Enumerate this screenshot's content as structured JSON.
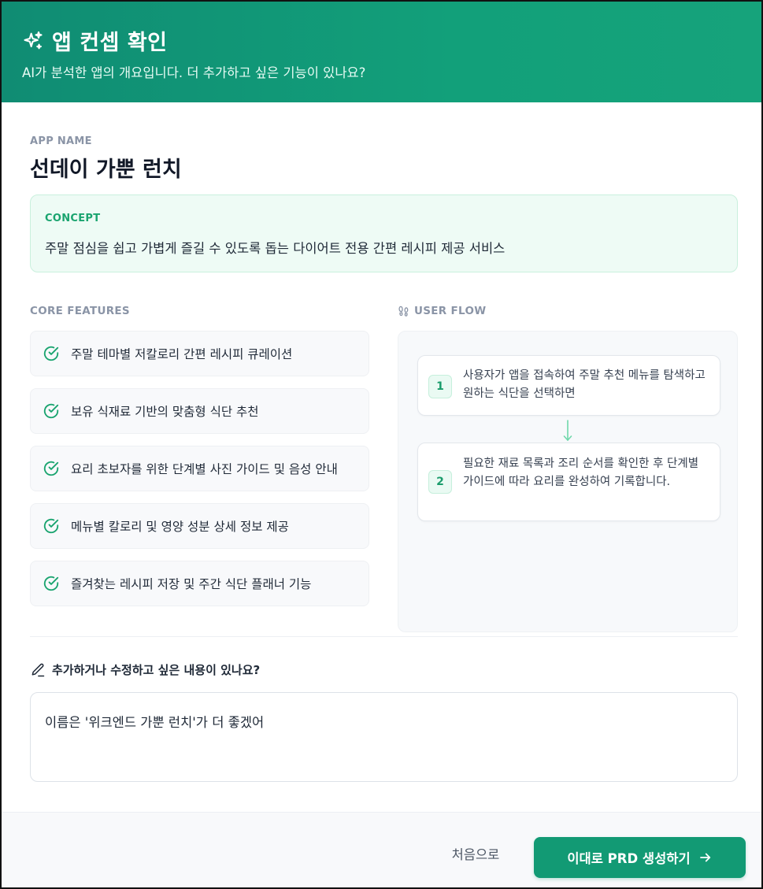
{
  "header": {
    "title": "앱 컨셉 확인",
    "subtitle": "AI가 분석한 앱의 개요입니다. 더 추가하고 싶은 기능이 있나요?"
  },
  "app": {
    "name_label": "APP NAME",
    "name": "선데이 가뿐 런치"
  },
  "concept": {
    "label": "CONCEPT",
    "text": "주말 점심을 쉽고 가볍게 즐길 수 있도록 돕는 다이어트 전용 간편 레시피 제공 서비스"
  },
  "features": {
    "label": "CORE FEATURES",
    "items": [
      "주말 테마별 저칼로리 간편 레시피 큐레이션",
      "보유 식재료 기반의 맞춤형 식단 추천",
      "요리 초보자를 위한 단계별 사진 가이드 및 음성 안내",
      "메뉴별 칼로리 및 영양 성분 상세 정보 제공",
      "즐겨찾는 레시피 저장 및 주간 식단 플래너 기능"
    ]
  },
  "user_flow": {
    "label": "USER FLOW",
    "steps": [
      {
        "num": "1",
        "text": "사용자가 앱을 접속하여 주말 추천 메뉴를 탐색하고 원하는 식단을 선택하면"
      },
      {
        "num": "2",
        "text": "필요한 재료 목록과 조리 순서를 확인한 후 단계별 가이드에 따라 요리를 완성하여 기록합니다."
      }
    ]
  },
  "edit": {
    "label": "추가하거나 수정하고 싶은 내용이 있나요?",
    "value": "이름은 '위크엔드 가뿐 런치'가 더 좋겠어"
  },
  "footer": {
    "back_label": "처음으로",
    "generate_label": "이대로 PRD 생성하기"
  },
  "colors": {
    "accent": "#129a74",
    "concept_bg": "#eefbf5",
    "check": "#1aa46f"
  }
}
